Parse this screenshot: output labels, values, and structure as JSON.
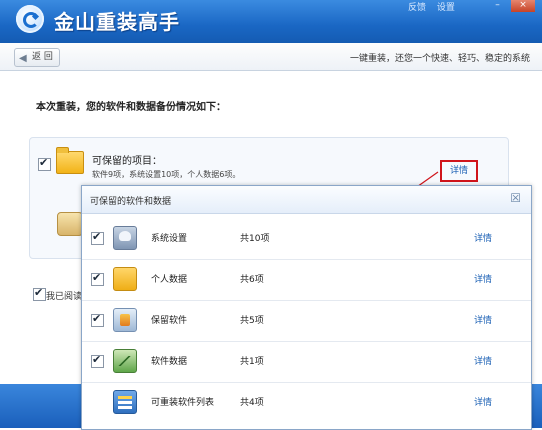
{
  "titlebar": {
    "app_title": "金山重装高手",
    "link_feedback": "反馈",
    "link_settings": "设置",
    "min_glyph": "–",
    "close_glyph": "×"
  },
  "subheader": {
    "back_label": "返 回",
    "slogan": "一键重装，还您一个快速、轻巧、稳定的系统"
  },
  "main": {
    "heading": "本次重装，您的软件和数据备份情况如下：",
    "keep_title": "可保留的项目：",
    "keep_desc": "软件9项，系统设置10项，个人数据6项。",
    "detail_label": "详情",
    "agree_text": "我已阅读"
  },
  "popup": {
    "title": "可保留的软件和数据",
    "close_glyph": "☒",
    "rows": [
      {
        "name": "系统设置",
        "count": "共10项",
        "detail": "详情",
        "checked": true,
        "icon": "system-settings-icon"
      },
      {
        "name": "个人数据",
        "count": "共6项",
        "detail": "详情",
        "checked": true,
        "icon": "folder-icon"
      },
      {
        "name": "保留软件",
        "count": "共5项",
        "detail": "详情",
        "checked": true,
        "icon": "software-box-icon"
      },
      {
        "name": "软件数据",
        "count": "共1项",
        "detail": "详情",
        "checked": true,
        "icon": "data-chart-icon"
      },
      {
        "name": "可重装软件列表",
        "count": "共4项",
        "detail": "详情",
        "checked": false,
        "icon": "list-icon"
      }
    ]
  },
  "colors": {
    "titlebar": "#1a67c4",
    "link": "#1a5fb4",
    "highlight_box": "#d0141b"
  }
}
